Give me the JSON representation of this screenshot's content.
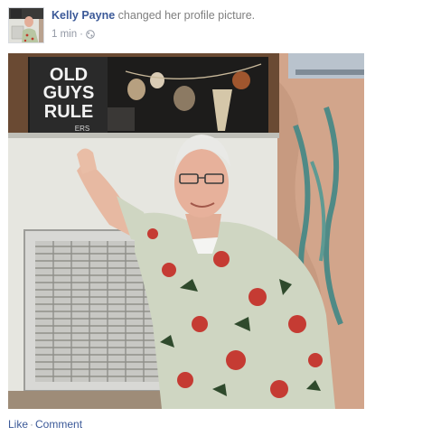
{
  "post": {
    "author": "Kelly Payne",
    "action": " changed her profile picture.",
    "timestamp": "1 min",
    "time_separator": "·",
    "privacy_icon": "globe-icon"
  },
  "photo": {
    "sign_text": [
      "OLD",
      "GUYS",
      "RULE"
    ],
    "sign_subtext": "ERS"
  },
  "footer": {
    "like_label": "Like",
    "separator": "·",
    "comment_label": "Comment"
  },
  "colors": {
    "link_blue": "#3b5998",
    "meta_gray": "#9197a3"
  }
}
